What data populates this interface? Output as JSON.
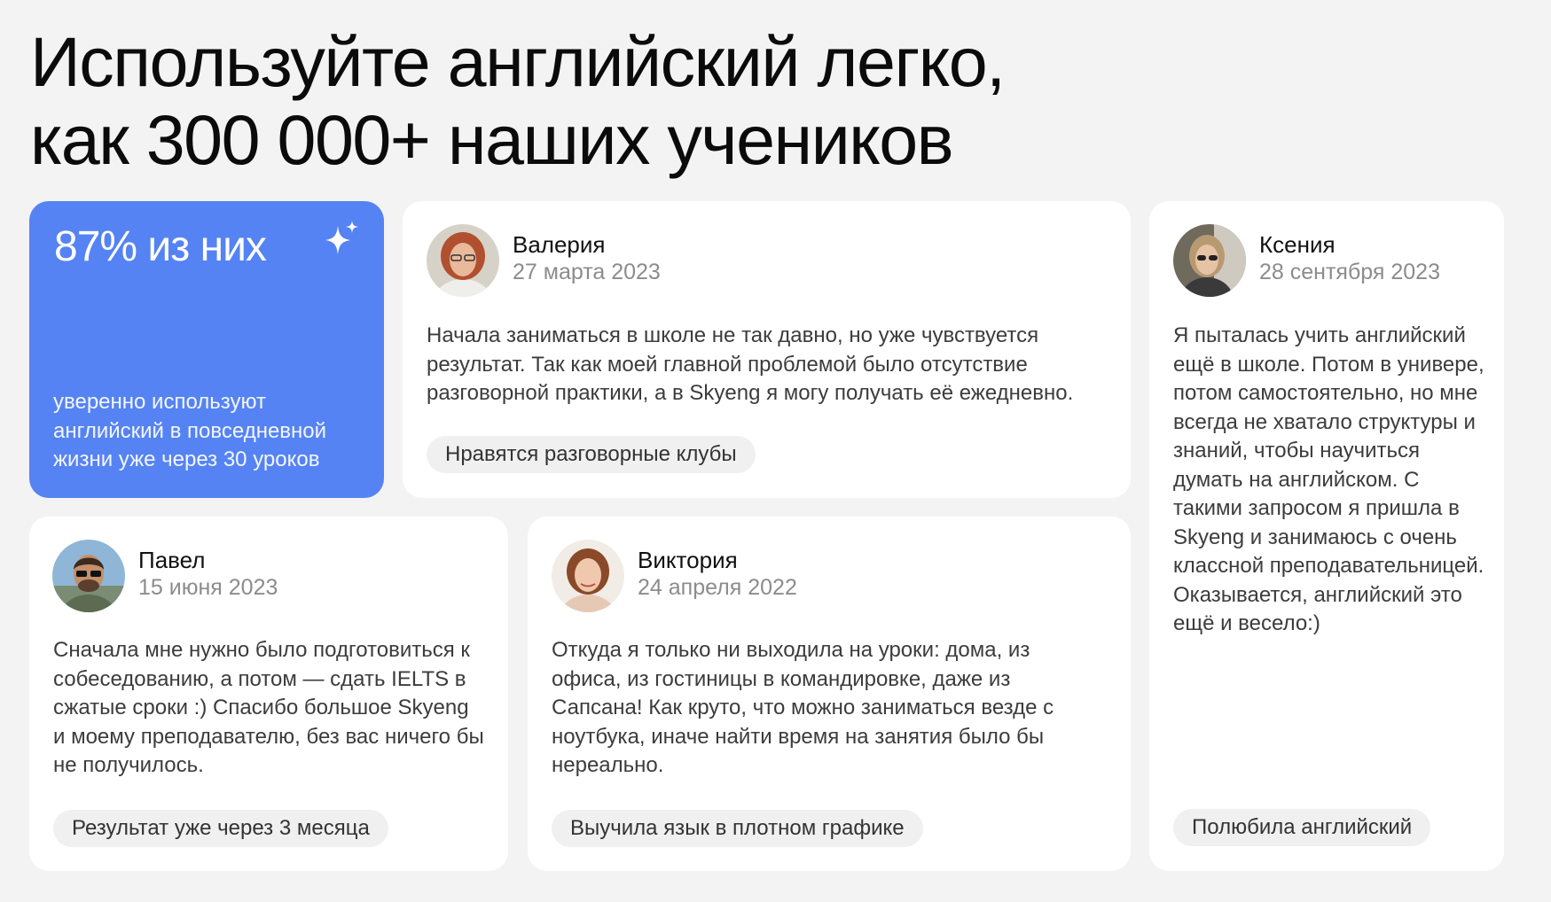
{
  "heading": {
    "line1": "Используйте английский легко,",
    "line2": "как 300 000+ наших учеников"
  },
  "stat": {
    "headline": "87% из них",
    "text": "уверенно используют английский в повседневной жизни уже через 30 уроков",
    "icon": "sparkle-icon",
    "color": "#5583f3"
  },
  "reviews": [
    {
      "name": "Валерия",
      "date": "27 марта 2023",
      "text": "Начала заниматься в школе не так давно, но уже чувствуется результат. Так как моей главной проблемой было отсутствие разговорной практики, а в Skyeng я могу получать её ежедневно.",
      "tag": "Нравятся разговорные клубы"
    },
    {
      "name": "Ксения",
      "date": "28 сентября 2023",
      "text": "Я пыталась учить английский ещё в школе. Потом в универе, потом самостоятельно, но мне всегда не хватало структуры и знаний, чтобы научиться думать на английском. С такими запросом я пришла в Skyeng и занимаюсь с очень классной преподавательницей. Оказывается, английский это ещё и весело:)",
      "tag": "Полюбила английский"
    },
    {
      "name": "Павел",
      "date": "15 июня 2023",
      "text": "Сначала мне нужно было подготовиться к собеседованию, а потом — сдать IELTS в сжатые сроки :) Спасибо большое Skyeng и моему преподавателю, без вас ничего бы не получилось.",
      "tag": "Результат уже через 3 месяца"
    },
    {
      "name": "Виктория",
      "date": "24 апреля 2022",
      "text": "Откуда я только ни выходила на уроки: дома, из офиса, из гостиницы в командировке, даже из Сапсана! Как круто, что можно заниматься везде с ноутбука, иначе найти время на занятия было бы нереально.",
      "tag": "Выучила язык в плотном графике"
    }
  ]
}
